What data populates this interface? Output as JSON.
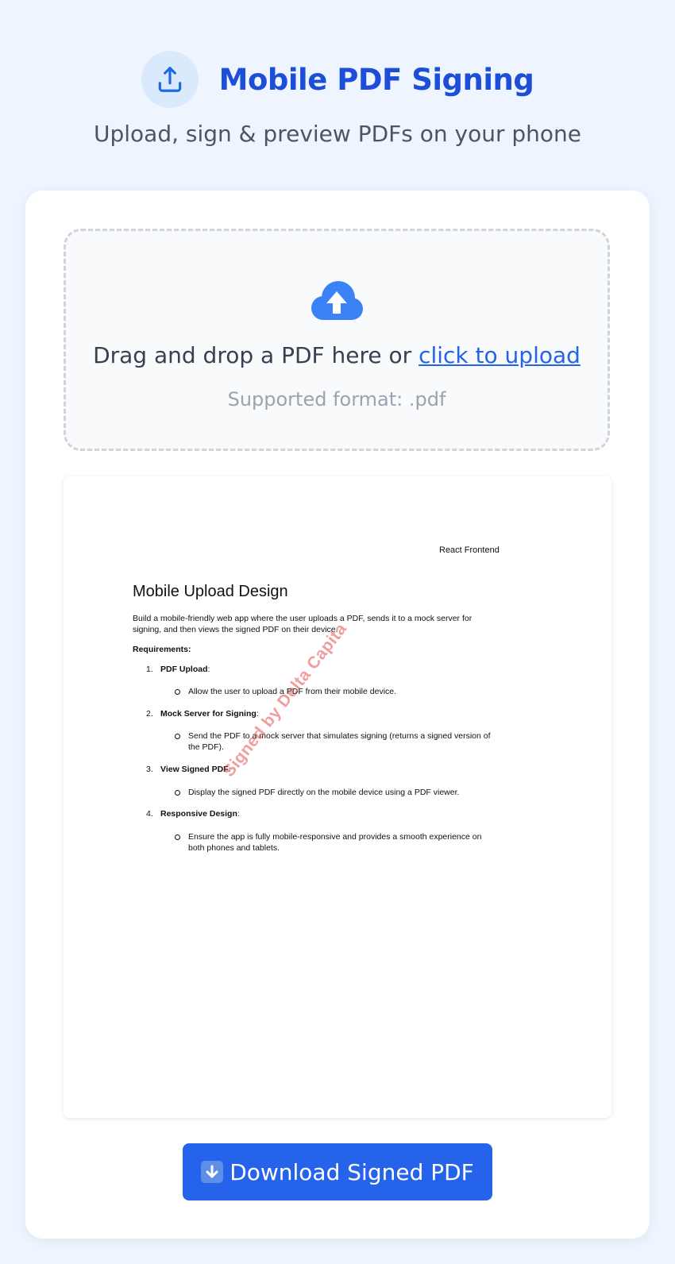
{
  "header": {
    "title": "Mobile PDF Signing",
    "subtitle": "Upload, sign & preview PDFs on your phone",
    "logo_icon": "upload-icon"
  },
  "upload": {
    "icon": "cloud-upload-icon",
    "text_prefix": "Drag and drop a PDF here or ",
    "link_text": "click to upload",
    "format_text": "Supported format: .pdf"
  },
  "pdf": {
    "header_right": "React Frontend",
    "title": "Mobile Upload Design",
    "intro": "Build a mobile-friendly web app where the user uploads a PDF, sends it to a mock server for signing, and then views the signed PDF on their device.",
    "requirements_label": "Requirements:",
    "items": [
      {
        "num": "1.",
        "title": "PDF Upload",
        "desc": "Allow the user to upload a PDF from their mobile device."
      },
      {
        "num": "2.",
        "title": "Mock Server for Signing",
        "desc": "Send the PDF to a mock server that simulates signing (returns a signed version of the PDF)."
      },
      {
        "num": "3.",
        "title": "View Signed PDF",
        "desc": "Display the signed PDF directly on the mobile device using a PDF viewer."
      },
      {
        "num": "4.",
        "title": "Responsive Design",
        "desc": "Ensure the app is fully mobile-responsive and provides a smooth experience on both phones and tablets."
      }
    ],
    "watermark": "Signed by Delta Capita"
  },
  "download": {
    "label": "Download Signed PDF",
    "icon": "down-arrow-icon"
  },
  "colors": {
    "accent": "#2563eb",
    "title": "#1d4ed8",
    "background": "#eef5fe",
    "watermark": "#dc2626"
  }
}
